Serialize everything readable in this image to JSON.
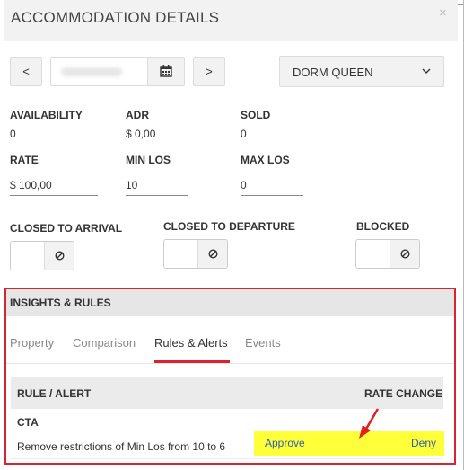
{
  "header": {
    "title": "ACCOMMODATION DETAILS",
    "close_glyph": "×"
  },
  "nav": {
    "prev_label": "<",
    "next_label": ">",
    "calendar_icon": "calendar-icon",
    "room_type": "DORM QUEEN",
    "room_icon": "chevron-down-icon"
  },
  "stats": {
    "availability": {
      "label": "AVAILABILITY",
      "value": "0"
    },
    "adr": {
      "label": "ADR",
      "value": "$ 0,00"
    },
    "sold": {
      "label": "SOLD",
      "value": "0"
    }
  },
  "rates": {
    "rate": {
      "label": "RATE",
      "value": "$ 100,00"
    },
    "min_los": {
      "label": "MIN LOS",
      "value": "10"
    },
    "max_los": {
      "label": "MAX LOS",
      "value": "0"
    }
  },
  "restrictions": {
    "closed_to_arrival": "CLOSED TO ARRIVAL",
    "closed_to_departure": "CLOSED TO DEPARTURE",
    "blocked": "BLOCKED",
    "toggle_icon": "ban-icon"
  },
  "insights": {
    "title": "INSIGHTS & RULES",
    "tabs": [
      {
        "label": "Property",
        "active": false
      },
      {
        "label": "Comparison",
        "active": false
      },
      {
        "label": "Rules & Alerts",
        "active": true
      },
      {
        "label": "Events",
        "active": false
      }
    ],
    "table": {
      "columns": [
        "RULE / ALERT",
        "RATE CHANGE"
      ],
      "rows": [
        {
          "rule": "CTA",
          "description": "Remove restrictions of Min Los from 10 to 6",
          "approve_label": "Approve",
          "deny_label": "Deny"
        }
      ]
    }
  },
  "colors": {
    "accent": "#d9232e",
    "highlight": "#ffff3a",
    "link": "#2a5fb0"
  }
}
